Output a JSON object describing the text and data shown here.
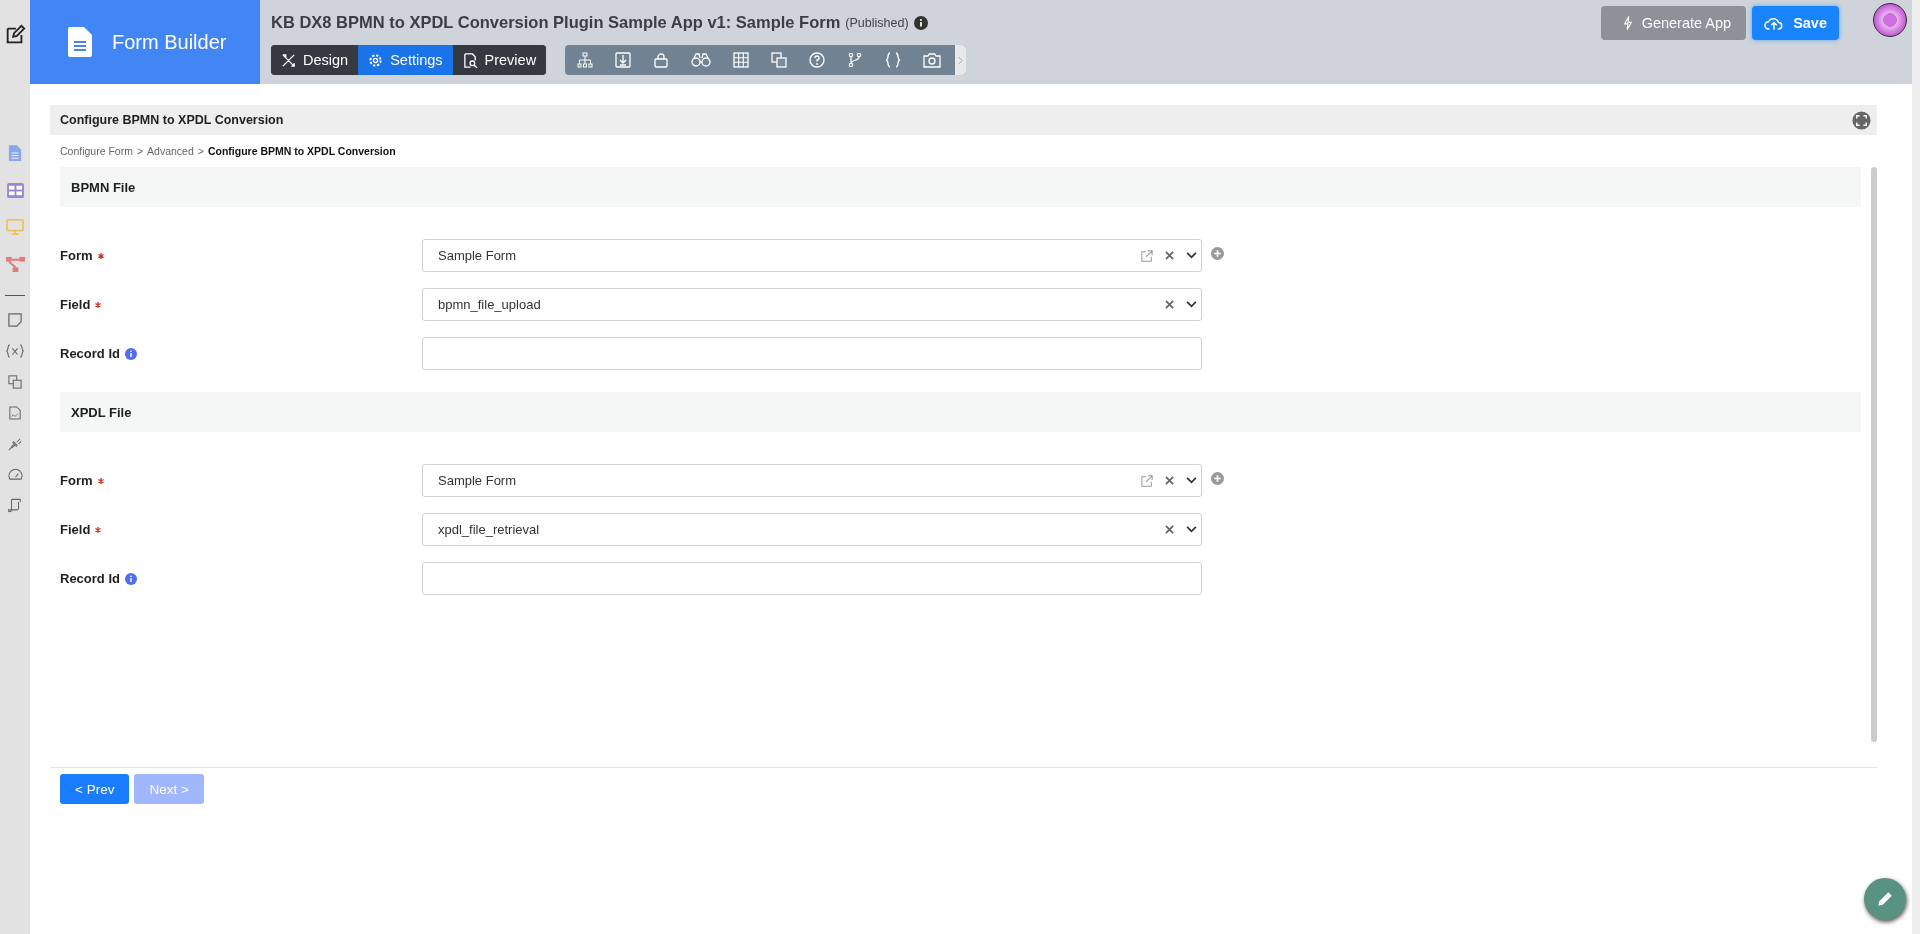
{
  "header": {
    "brand": "Form Builder",
    "title": "KB DX8 BPMN to XPDL Conversion Plugin Sample App v1: Sample Form",
    "status": "(Published)",
    "modes": [
      {
        "label": "Design",
        "selected": false
      },
      {
        "label": "Settings",
        "selected": true
      },
      {
        "label": "Preview",
        "selected": false
      }
    ],
    "actions": [
      {
        "label": "Generate App",
        "kind": "secondary"
      },
      {
        "label": "Save",
        "kind": "primary"
      }
    ]
  },
  "panel": {
    "title": "Configure BPMN to XPDL Conversion",
    "breadcrumb": {
      "separator": ">",
      "items": [
        {
          "label": "Configure Form",
          "current": false
        },
        {
          "label": "Advanced",
          "current": false
        },
        {
          "label": "Configure BPMN to XPDL Conversion",
          "current": true
        }
      ]
    },
    "sections": [
      {
        "title": "BPMN File",
        "fields": [
          {
            "label": "Form",
            "required": true,
            "kind": "select",
            "value": "Sample Form",
            "edit_link": true,
            "add_button": true
          },
          {
            "label": "Field",
            "required": true,
            "kind": "select",
            "value": "bpmn_file_upload",
            "edit_link": false,
            "add_button": false
          },
          {
            "label": "Record Id",
            "required": false,
            "kind": "text",
            "info": true
          }
        ]
      },
      {
        "title": "XPDL File",
        "fields": [
          {
            "label": "Form",
            "required": true,
            "kind": "select",
            "value": "Sample Form",
            "edit_link": true,
            "add_button": true
          },
          {
            "label": "Field",
            "required": true,
            "kind": "select",
            "value": "xpdl_file_retrieval",
            "edit_link": false,
            "add_button": false
          },
          {
            "label": "Record Id",
            "required": false,
            "kind": "text",
            "info": true
          }
        ]
      }
    ],
    "footer": [
      {
        "label": "< Prev",
        "disabled": false
      },
      {
        "label": "Next >",
        "disabled": true
      }
    ]
  }
}
